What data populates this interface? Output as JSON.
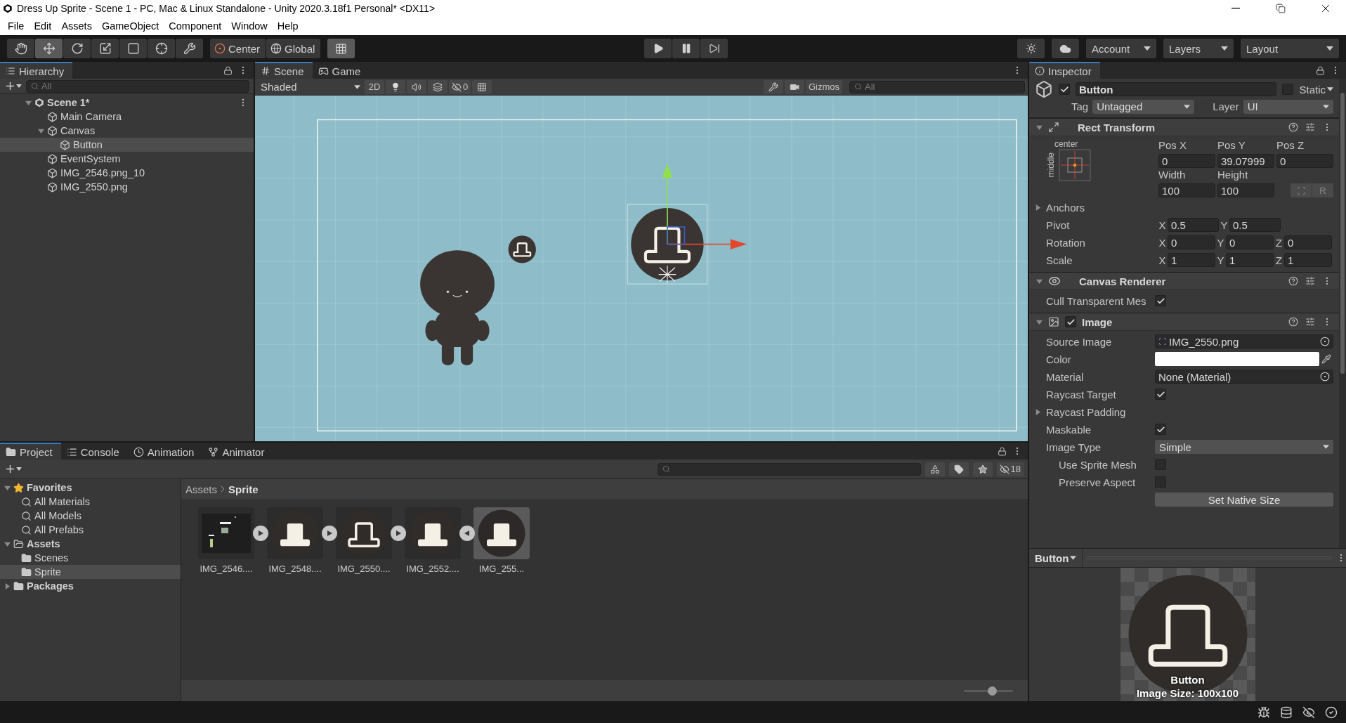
{
  "window": {
    "title": "Dress Up Sprite - Scene 1 - PC, Mac & Linux Standalone - Unity 2020.3.18f1 Personal* <DX11>"
  },
  "menu": [
    "File",
    "Edit",
    "Assets",
    "GameObject",
    "Component",
    "Window",
    "Help"
  ],
  "toolbar": {
    "tools": [
      {
        "kind": "hand",
        "selected": false
      },
      {
        "kind": "move",
        "selected": true
      },
      {
        "kind": "rotate",
        "selected": false
      },
      {
        "kind": "scale",
        "selected": false
      },
      {
        "kind": "rect",
        "selected": false
      },
      {
        "kind": "transform",
        "selected": false
      },
      {
        "kind": "custom",
        "selected": false
      }
    ],
    "pivot": [
      {
        "kind": "pivot",
        "label": "Center"
      },
      {
        "kind": "space",
        "label": "Global"
      }
    ],
    "grid_snap": {
      "on": true
    },
    "menus": [
      "Account",
      "Layers",
      "Layout"
    ]
  },
  "hierarchy": {
    "title": "Hierarchy",
    "search": {
      "placeholder": "All"
    },
    "items": [
      {
        "kind": "scene",
        "label": "Scene 1*",
        "selected": false,
        "expanded": true,
        "children": [
          {
            "kind": "object",
            "label": "Main Camera",
            "selected": false
          },
          {
            "kind": "object",
            "label": "Canvas",
            "selected": false,
            "expanded": true,
            "children": [
              {
                "kind": "object",
                "label": "Button",
                "selected": true
              }
            ]
          },
          {
            "kind": "object",
            "label": "EventSystem",
            "selected": false
          },
          {
            "kind": "object",
            "label": "IMG_2546.png_10",
            "selected": false
          },
          {
            "kind": "object",
            "label": "IMG_2550.png",
            "selected": false
          }
        ]
      }
    ]
  },
  "scene": {
    "tabs": [
      {
        "kind": "scene",
        "label": "Scene",
        "selected": true
      },
      {
        "kind": "game",
        "label": "Game",
        "selected": false
      }
    ],
    "shading": "Shaded",
    "mode_2d": {
      "label": "2D",
      "on": false
    },
    "hidden_count": "0",
    "gizmos": "Gizmos",
    "search": {
      "placeholder": "All"
    }
  },
  "inspector": {
    "title": "Inspector",
    "active": true,
    "name": "Button",
    "static": {
      "label": "Static",
      "checked": false
    },
    "tag": {
      "label": "Tag",
      "value": "Untagged"
    },
    "layer": {
      "label": "Layer",
      "value": "UI"
    },
    "components": [
      {
        "kind": "rect_transform",
        "title": "Rect Transform",
        "expanded": true,
        "anchor": {
          "horizontal": "center",
          "vertical": "middle"
        },
        "fields": [
          {
            "label": "Pos X",
            "value": "0"
          },
          {
            "label": "Pos Y",
            "value": "39.07999"
          },
          {
            "label": "Pos Z",
            "value": "0"
          },
          {
            "label": "Width",
            "value": "100"
          },
          {
            "label": "Height",
            "value": "100"
          }
        ],
        "raw_button": "R",
        "rows": [
          {
            "kind": "foldout",
            "label": "Anchors",
            "expanded": false
          },
          {
            "kind": "vector",
            "label": "Pivot",
            "axes": [
              {
                "axis": "X",
                "value": "0.5"
              },
              {
                "axis": "Y",
                "value": "0.5"
              }
            ]
          },
          {
            "kind": "vector",
            "label": "Rotation",
            "axes": [
              {
                "axis": "X",
                "value": "0"
              },
              {
                "axis": "Y",
                "value": "0"
              },
              {
                "axis": "Z",
                "value": "0"
              }
            ]
          },
          {
            "kind": "vector",
            "label": "Scale",
            "axes": [
              {
                "axis": "X",
                "value": "1"
              },
              {
                "axis": "Y",
                "value": "1"
              },
              {
                "axis": "Z",
                "value": "1"
              }
            ]
          }
        ]
      },
      {
        "kind": "canvas_renderer",
        "title": "Canvas Renderer",
        "expanded": true,
        "rows": [
          {
            "kind": "toggle",
            "label": "Cull Transparent Mes",
            "checked": true
          }
        ]
      },
      {
        "kind": "image",
        "title": "Image",
        "expanded": true,
        "enabled": true,
        "rows": [
          {
            "kind": "object",
            "label": "Source Image",
            "value": "IMG_2550.png"
          },
          {
            "kind": "color",
            "label": "Color"
          },
          {
            "kind": "object",
            "label": "Material",
            "value": "None (Material)"
          },
          {
            "kind": "toggle",
            "label": "Raycast Target",
            "checked": true
          },
          {
            "kind": "foldout",
            "label": "Raycast Padding",
            "expanded": false
          },
          {
            "kind": "toggle",
            "label": "Maskable",
            "checked": true
          },
          {
            "kind": "dropdown",
            "label": "Image Type",
            "value": "Simple",
            "children": [
              {
                "kind": "toggle",
                "label": "Use Sprite Mesh",
                "checked": false
              },
              {
                "kind": "toggle",
                "label": "Preserve Aspect",
                "checked": false
              }
            ]
          },
          {
            "kind": "button",
            "label": "Set Native Size"
          }
        ]
      }
    ],
    "preview": {
      "title": "Button",
      "caption": "Button",
      "size_text": "Image Size: 100x100"
    }
  },
  "project": {
    "tabs": [
      {
        "kind": "project",
        "label": "Project",
        "selected": true
      },
      {
        "kind": "console",
        "label": "Console",
        "selected": false
      },
      {
        "kind": "animation",
        "label": "Animation",
        "selected": false
      },
      {
        "kind": "animator",
        "label": "Animator",
        "selected": false
      }
    ],
    "hidden_count": "18",
    "tree": [
      {
        "kind": "favorites",
        "label": "Favorites",
        "selected": false,
        "expanded": true,
        "children": [
          {
            "kind": "search",
            "label": "All Materials",
            "selected": false
          },
          {
            "kind": "search",
            "label": "All Models",
            "selected": false
          },
          {
            "kind": "search",
            "label": "All Prefabs",
            "selected": false
          }
        ]
      },
      {
        "kind": "folder",
        "label": "Assets",
        "selected": false,
        "expanded": true,
        "children": [
          {
            "kind": "folder",
            "label": "Scenes",
            "selected": false
          },
          {
            "kind": "folder",
            "label": "Sprite",
            "selected": true
          }
        ]
      },
      {
        "kind": "folder",
        "label": "Packages",
        "selected": false,
        "expanded": false
      }
    ],
    "breadcrumb": [
      "Assets",
      "Sprite"
    ],
    "assets": [
      {
        "kind": "sheet",
        "label": "IMG_2546....",
        "selected": false,
        "expanded": false
      },
      {
        "kind": "hat_solid",
        "label": "IMG_2548....",
        "selected": false,
        "expanded": false
      },
      {
        "kind": "hat_outline",
        "label": "IMG_2550....",
        "selected": false,
        "expanded": false
      },
      {
        "kind": "hat_solid",
        "label": "IMG_2552....",
        "selected": false,
        "expanded": true,
        "children": [
          {
            "kind": "hat_solid",
            "label": "IMG_255...",
            "selected": true
          }
        ]
      }
    ],
    "zoom": {
      "level": 0.58
    }
  }
}
